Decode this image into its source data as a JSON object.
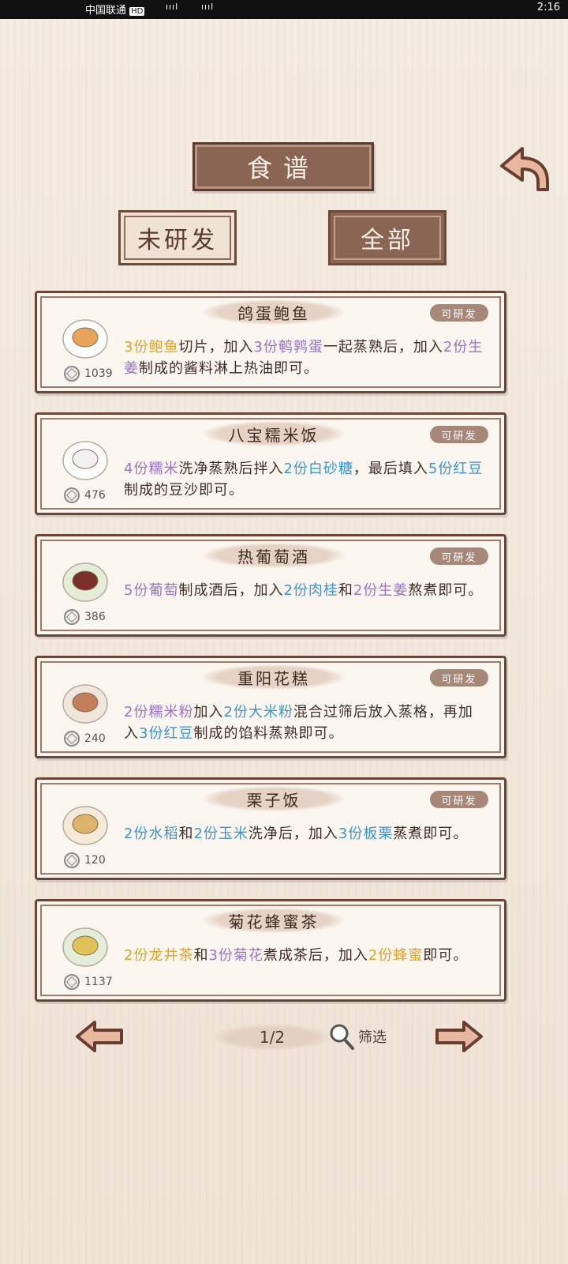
{
  "status_bar": {
    "carrier": "中国联通",
    "hd": "HD",
    "signal1": "ıııl",
    "signal2": "ıııl",
    "time": "2:16"
  },
  "header": {
    "title": "食谱"
  },
  "tabs": [
    {
      "label": "未研发"
    },
    {
      "label": "全部"
    }
  ],
  "recipes": [
    {
      "name": "鸽蛋鲍鱼",
      "badge": "可研发",
      "price": "1039",
      "dish_icon": "abalone-dish-icon",
      "desc": [
        {
          "t": "3份",
          "c": "y"
        },
        {
          "t": "鲍鱼",
          "c": "y"
        },
        {
          "t": "切片，加入"
        },
        {
          "t": "3份",
          "c": "p"
        },
        {
          "t": "鹌鹑蛋",
          "c": "p"
        },
        {
          "t": "一起蒸熟后，加入"
        },
        {
          "t": "2份",
          "c": "p"
        },
        {
          "t": "生姜",
          "c": "p"
        },
        {
          "t": "制成的酱料淋上热油即可。"
        }
      ]
    },
    {
      "name": "八宝糯米饭",
      "badge": "可研发",
      "price": "476",
      "dish_icon": "rice-bowl-icon",
      "desc": [
        {
          "t": "4份",
          "c": "p"
        },
        {
          "t": "糯米",
          "c": "p"
        },
        {
          "t": "洗净蒸熟后拌入"
        },
        {
          "t": "2份",
          "c": "b"
        },
        {
          "t": "白砂糖",
          "c": "b"
        },
        {
          "t": "，最后填入"
        },
        {
          "t": "5份",
          "c": "b"
        },
        {
          "t": "红豆",
          "c": "b"
        },
        {
          "t": "制成的豆沙即可。"
        }
      ]
    },
    {
      "name": "热葡萄酒",
      "badge": "可研发",
      "price": "386",
      "dish_icon": "wine-cup-icon",
      "desc": [
        {
          "t": "5份",
          "c": "p"
        },
        {
          "t": "葡萄",
          "c": "p"
        },
        {
          "t": "制成酒后，加入"
        },
        {
          "t": "2份",
          "c": "b"
        },
        {
          "t": "肉桂",
          "c": "b"
        },
        {
          "t": "和"
        },
        {
          "t": "2份",
          "c": "p"
        },
        {
          "t": "生姜",
          "c": "p"
        },
        {
          "t": "熬煮即可。"
        }
      ]
    },
    {
      "name": "重阳花糕",
      "badge": "可研发",
      "price": "240",
      "dish_icon": "flower-cake-icon",
      "desc": [
        {
          "t": "2份",
          "c": "p"
        },
        {
          "t": "糯米粉",
          "c": "p"
        },
        {
          "t": "加入"
        },
        {
          "t": "2份",
          "c": "b"
        },
        {
          "t": "大米粉",
          "c": "b"
        },
        {
          "t": "混合过筛后放入蒸格，再加入"
        },
        {
          "t": "3份",
          "c": "b"
        },
        {
          "t": "红豆",
          "c": "b"
        },
        {
          "t": "制成的馅料蒸熟即可。"
        }
      ]
    },
    {
      "name": "栗子饭",
      "badge": "可研发",
      "price": "120",
      "dish_icon": "chestnut-rice-icon",
      "desc": [
        {
          "t": "2份",
          "c": "b"
        },
        {
          "t": "水稻",
          "c": "b"
        },
        {
          "t": "和"
        },
        {
          "t": "2份",
          "c": "b"
        },
        {
          "t": "玉米",
          "c": "b"
        },
        {
          "t": "洗净后，加入"
        },
        {
          "t": "3份",
          "c": "b"
        },
        {
          "t": "板栗",
          "c": "b"
        },
        {
          "t": "蒸煮即可。"
        }
      ]
    },
    {
      "name": "菊花蜂蜜茶",
      "badge": "",
      "price": "1137",
      "dish_icon": "tea-cup-icon",
      "desc": [
        {
          "t": "2份",
          "c": "y"
        },
        {
          "t": "龙井茶",
          "c": "y"
        },
        {
          "t": "和"
        },
        {
          "t": "3份",
          "c": "p"
        },
        {
          "t": "菊花",
          "c": "p"
        },
        {
          "t": "煮成茶后，加入"
        },
        {
          "t": "2份",
          "c": "y"
        },
        {
          "t": "蜂蜜",
          "c": "y"
        },
        {
          "t": "即可。"
        }
      ]
    }
  ],
  "pager": {
    "page": "1/2",
    "filter_label": "筛选"
  },
  "colors": {
    "yellow": "#e3a222",
    "purple": "#9a72c8",
    "blue": "#3a95d5",
    "plaque": "#8b6554"
  }
}
